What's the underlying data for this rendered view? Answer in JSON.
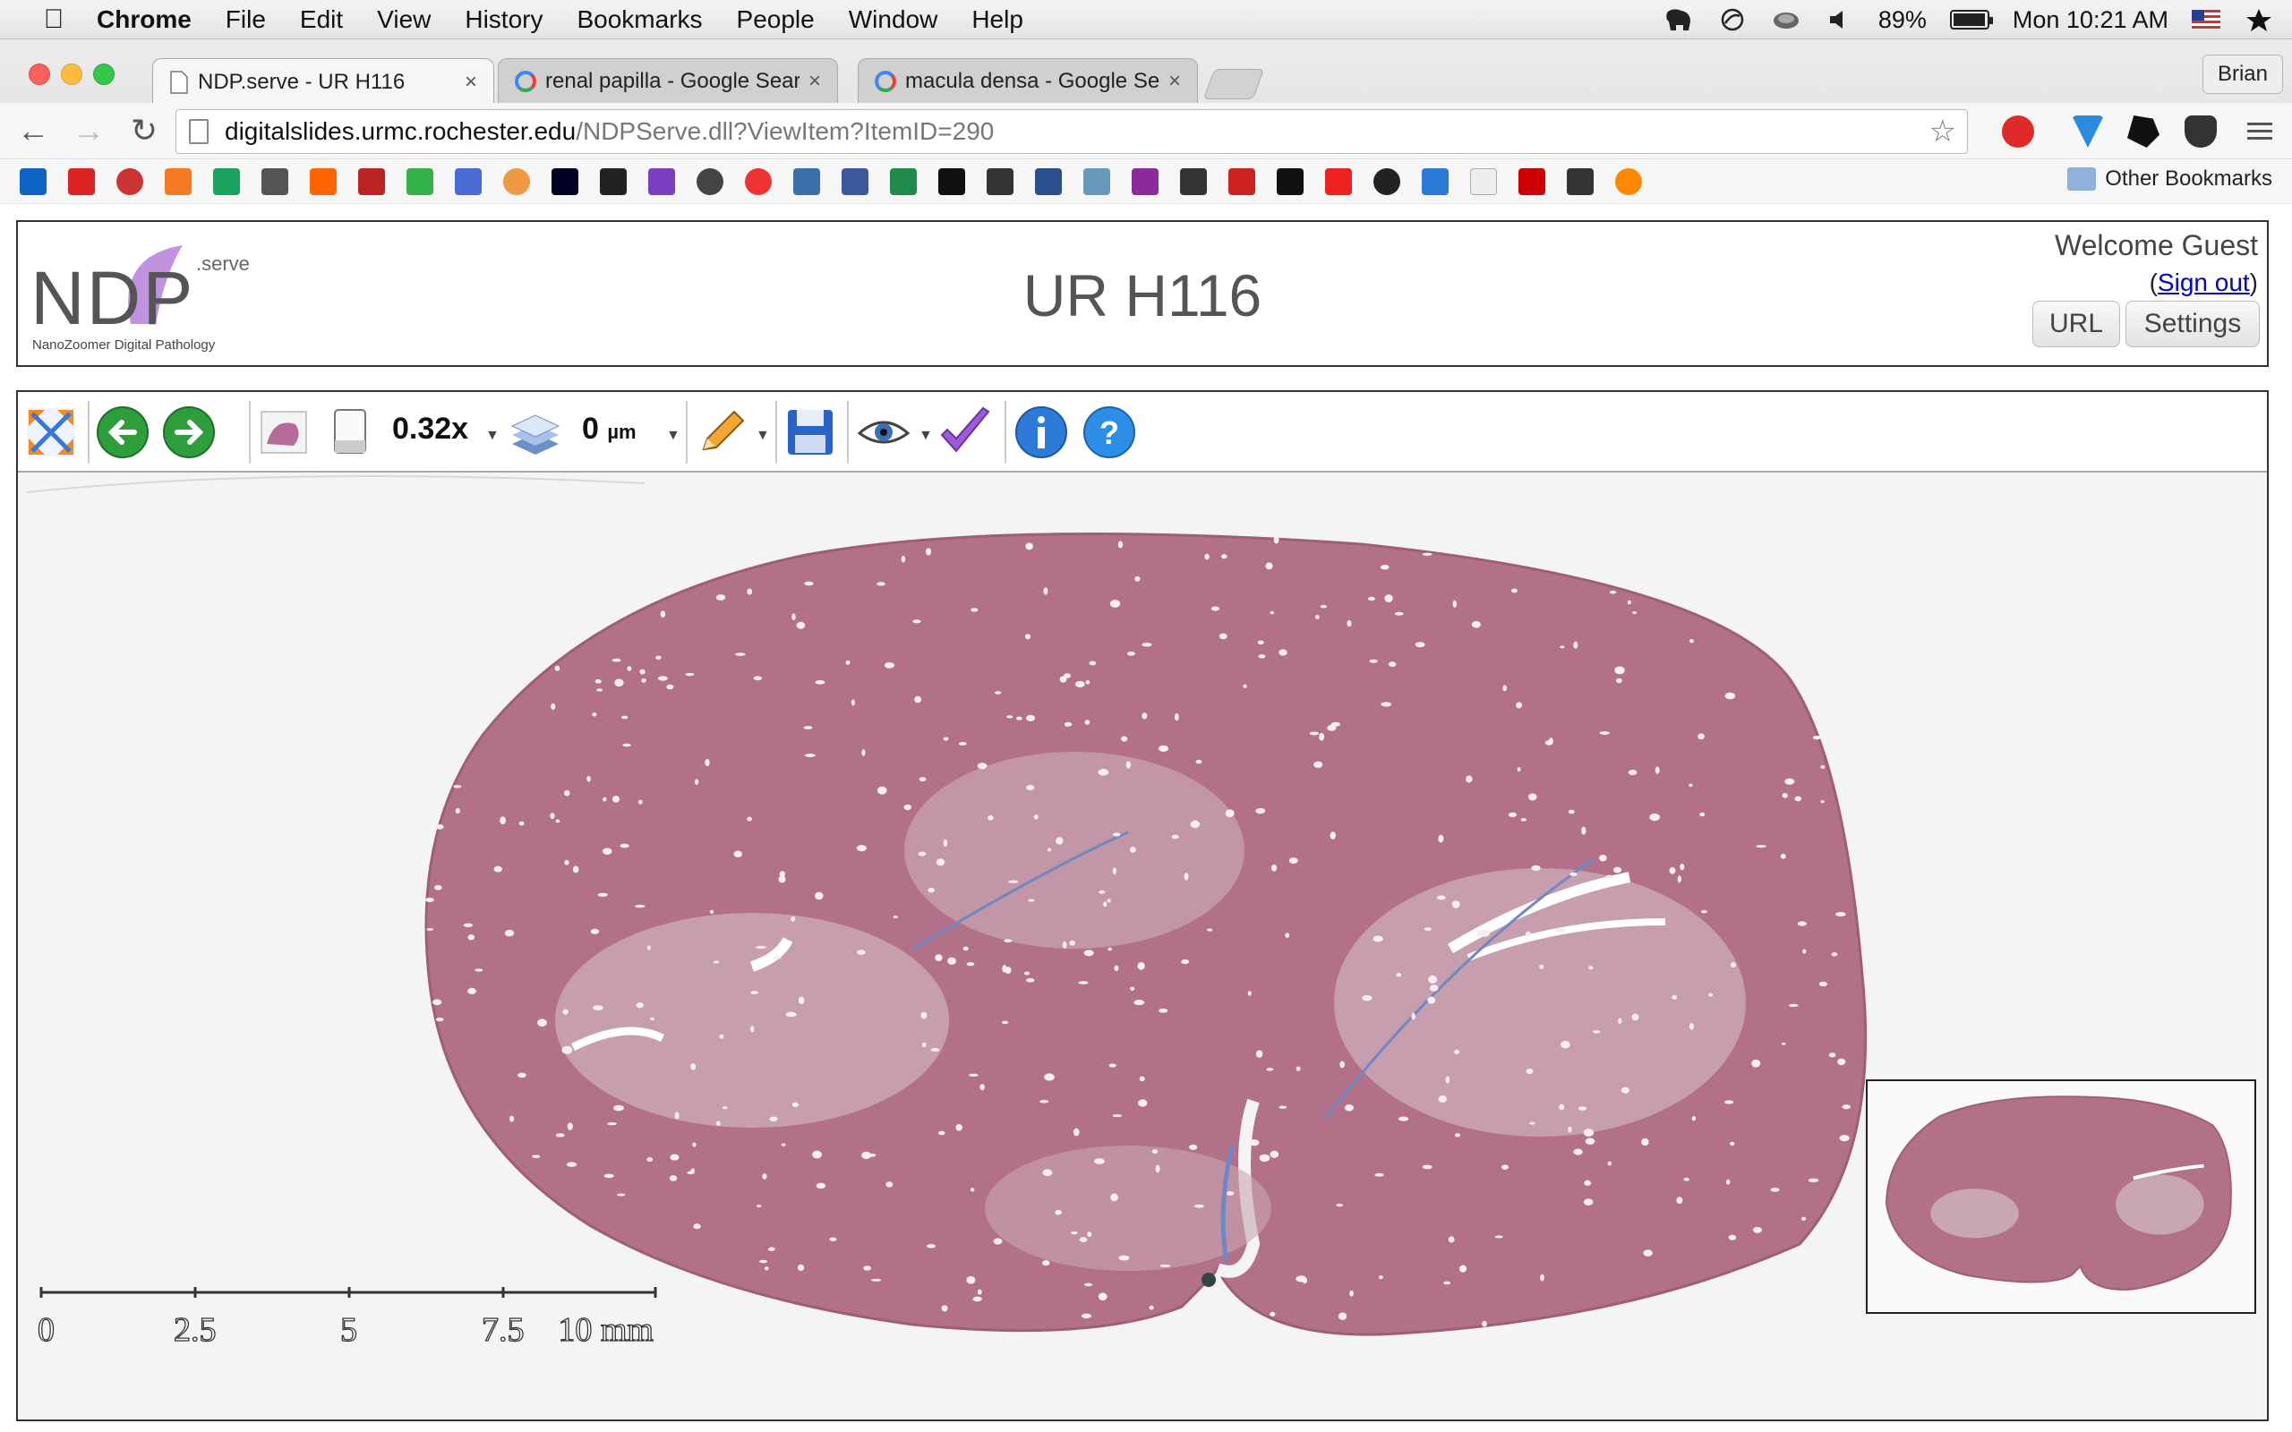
{
  "menubar": {
    "app": "Chrome",
    "menus": [
      "File",
      "Edit",
      "View",
      "History",
      "Bookmarks",
      "People",
      "Window",
      "Help"
    ],
    "battery": "89%",
    "battery_level": 0.89,
    "clock": "Mon 10:21 AM"
  },
  "browser": {
    "tabs": [
      {
        "title": "NDP.serve - UR H116",
        "close": "×"
      },
      {
        "title": "renal papilla - Google Search",
        "close": "×"
      },
      {
        "title": "macula densa - Google Search",
        "close": "×"
      }
    ],
    "profile": "Brian",
    "url_host": "digitalslides.urmc.rochester.edu",
    "url_path": "/NDPServe.dll?ViewItem?ItemID=290",
    "other_bookmarks": "Other Bookmarks"
  },
  "ndp": {
    "logo_serve": ".serve",
    "logo_letters": "NDP",
    "logo_tagline": "NanoZoomer Digital Pathology",
    "title": "UR H116",
    "welcome": "Welcome Guest",
    "signout_open": "(",
    "signout": "Sign out",
    "signout_close": ")",
    "url_button": "URL",
    "settings_button": "Settings",
    "zoom": "0.32x",
    "focus_value": "0",
    "focus_unit": "µm",
    "scale_labels": [
      "0",
      "2.5",
      "5",
      "7.5",
      "10 mm"
    ]
  },
  "colors": {
    "tissue": "#b27188",
    "tissue_light": "#c79aab",
    "medulla": "#c9a6b4",
    "stain_blue": "#6f87c4",
    "logo_purple": "#b57fd9"
  }
}
